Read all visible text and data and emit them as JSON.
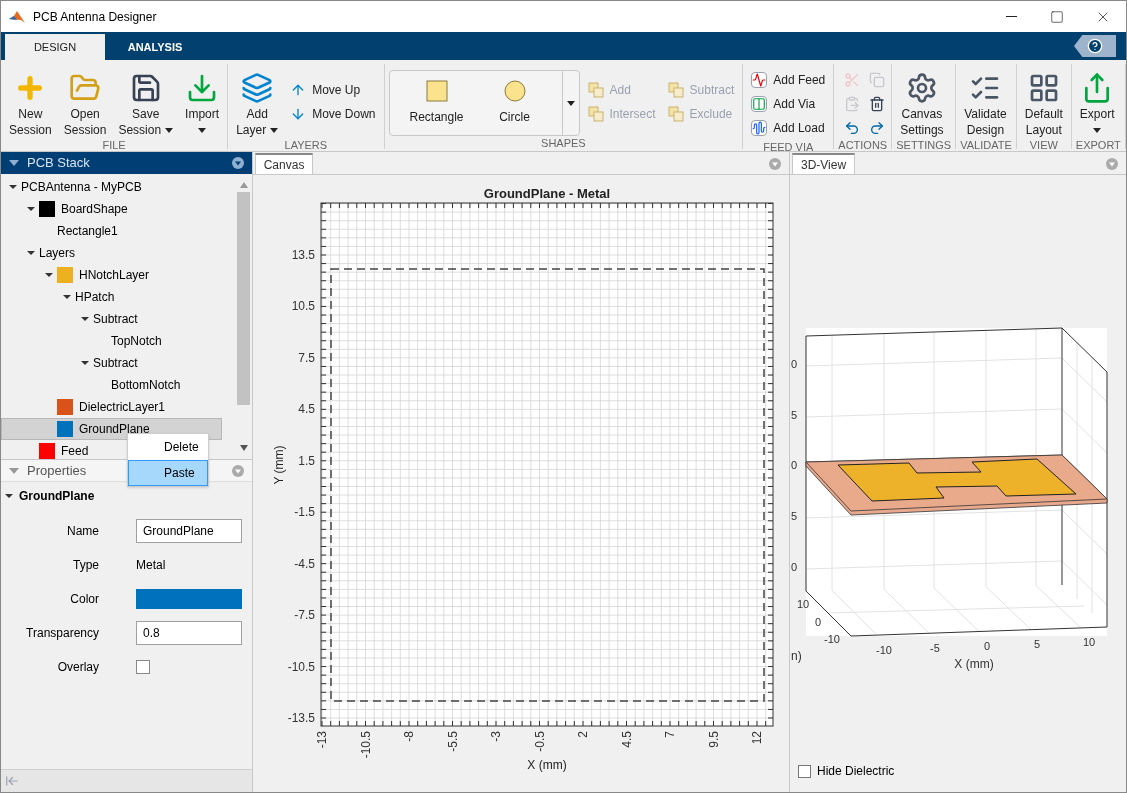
{
  "window": {
    "title": "PCB Antenna Designer"
  },
  "ribbon_tabs": [
    {
      "label": "DESIGN",
      "selected": true
    },
    {
      "label": "ANALYSIS",
      "selected": false
    }
  ],
  "ribbon_groups": [
    {
      "label": "FILE",
      "items": [
        {
          "kind": "large",
          "lines": [
            "New",
            "Session"
          ],
          "dropdown": false,
          "disabled": false
        },
        {
          "kind": "large",
          "lines": [
            "Open",
            "Session"
          ],
          "dropdown": false,
          "disabled": false
        },
        {
          "kind": "large",
          "lines": [
            "Save",
            "Session"
          ],
          "dropdown": true,
          "disabled": false
        },
        {
          "kind": "large",
          "lines": [
            "Import"
          ],
          "dropdown": true,
          "disabled": false
        }
      ]
    },
    {
      "label": "LAYERS",
      "items": [
        {
          "kind": "large",
          "lines": [
            "Add",
            "Layer"
          ],
          "dropdown": true,
          "disabled": false
        },
        {
          "kind": "small",
          "label": "Move Up",
          "disabled": false
        },
        {
          "kind": "small",
          "label": "Move Down",
          "disabled": false
        }
      ]
    },
    {
      "label": "SHAPES",
      "items": [
        {
          "kind": "gallery",
          "label": "Rectangle"
        },
        {
          "kind": "gallery",
          "label": "Circle"
        },
        {
          "kind": "small",
          "label": "Add",
          "disabled": true
        },
        {
          "kind": "small",
          "label": "Intersect",
          "disabled": true
        },
        {
          "kind": "small",
          "label": "Subtract",
          "disabled": true
        },
        {
          "kind": "small",
          "label": "Exclude",
          "disabled": true
        }
      ]
    },
    {
      "label": "FEED VIA",
      "items": [
        {
          "kind": "small",
          "label": "Add Feed",
          "disabled": false
        },
        {
          "kind": "small",
          "label": "Add Via",
          "disabled": false
        },
        {
          "kind": "small",
          "label": "Add Load",
          "disabled": false
        }
      ]
    },
    {
      "label": "ACTIONS",
      "items": [
        {
          "kind": "icon",
          "disabled": true
        },
        {
          "kind": "icon",
          "disabled": true
        },
        {
          "kind": "icon",
          "disabled": true
        },
        {
          "kind": "icon",
          "disabled": false
        },
        {
          "kind": "icon",
          "disabled": false
        },
        {
          "kind": "icon",
          "disabled": false
        }
      ]
    },
    {
      "label": "SETTINGS",
      "items": [
        {
          "kind": "large",
          "lines": [
            "Canvas",
            "Settings"
          ],
          "dropdown": false,
          "disabled": false
        }
      ]
    },
    {
      "label": "VALIDATE",
      "items": [
        {
          "kind": "large",
          "lines": [
            "Validate",
            "Design"
          ],
          "dropdown": false,
          "disabled": false
        }
      ]
    },
    {
      "label": "VIEW",
      "items": [
        {
          "kind": "large",
          "lines": [
            "Default",
            "Layout"
          ],
          "dropdown": false,
          "disabled": false
        }
      ]
    },
    {
      "label": "EXPORT",
      "items": [
        {
          "kind": "large",
          "lines": [
            "Export"
          ],
          "dropdown": true,
          "disabled": false
        }
      ]
    }
  ],
  "pcb_stack": {
    "header": "PCB Stack",
    "tree": [
      {
        "label": "PCBAntenna - MyPCB",
        "expanded": true,
        "selected": false,
        "children": [
          {
            "label": "BoardShape",
            "color": "#000000",
            "expanded": true,
            "selected": false,
            "children": [
              {
                "label": "Rectangle1",
                "selected": false
              }
            ]
          },
          {
            "label": "Layers",
            "expanded": true,
            "selected": false,
            "children": [
              {
                "label": "HNotchLayer",
                "color": "#edb120",
                "expanded": true,
                "selected": false,
                "children": [
                  {
                    "label": "HPatch",
                    "expanded": true,
                    "selected": false,
                    "children": [
                      {
                        "label": "Subtract",
                        "expanded": true,
                        "selected": false,
                        "children": [
                          {
                            "label": "TopNotch",
                            "selected": false
                          }
                        ]
                      },
                      {
                        "label": "Subtract",
                        "expanded": true,
                        "selected": false,
                        "children": [
                          {
                            "label": "BottomNotch",
                            "selected": false
                          }
                        ]
                      }
                    ]
                  }
                ]
              },
              {
                "label": "DielectricLayer1",
                "color": "#d95319",
                "selected": false
              },
              {
                "label": "GroundPlane",
                "color": "#0072bd",
                "selected": true
              }
            ]
          },
          {
            "label": "Feed",
            "color": "#ff0000",
            "selected": false
          }
        ]
      }
    ]
  },
  "context_menu": {
    "items": [
      {
        "label": "Delete",
        "selected": false
      },
      {
        "label": "Paste",
        "selected": true
      }
    ]
  },
  "properties": {
    "header": "Properties",
    "object": "GroundPlane",
    "expanded": true,
    "fields": [
      {
        "kind": "text_input",
        "label": "Name",
        "value": "GroundPlane"
      },
      {
        "kind": "text",
        "label": "Type",
        "value": "Metal"
      },
      {
        "kind": "color",
        "label": "Color",
        "color": "#0072bd"
      },
      {
        "kind": "text_input",
        "label": "Transparency",
        "value": "0.8"
      },
      {
        "kind": "checkbox",
        "label": "Overlay",
        "checked": false
      }
    ]
  },
  "canvas": {
    "tab": "Canvas",
    "title": "GroundPlane - Metal",
    "xlabel": "X (mm)",
    "ylabel": "Y (mm)",
    "xticks": [
      "-13",
      "-10.5",
      "-8",
      "-5.5",
      "-3",
      "-0.5",
      "2",
      "4.5",
      "7",
      "9.5",
      "12"
    ],
    "yticks": [
      "13.5",
      "10.5",
      "7.5",
      "4.5",
      "1.5",
      "-1.5",
      "-4.5",
      "-7.5",
      "-10.5",
      "-13.5"
    ]
  },
  "view3d": {
    "tab": "3D-View",
    "zticks": [
      "0",
      "5",
      "0",
      "5",
      "0"
    ],
    "yticks": [
      "10",
      "0",
      "-10"
    ],
    "xticks": [
      "-10",
      "-5",
      "0",
      "5",
      "10"
    ],
    "ylabel": "n)",
    "xlabel": "X (mm)",
    "hide_dielectric": {
      "label": "Hide Dielectric",
      "checked": false
    }
  }
}
